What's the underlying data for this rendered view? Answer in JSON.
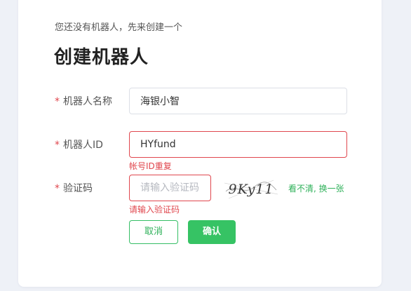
{
  "intro_text": "您还没有机器人，先来创建一个",
  "page_title": "创建机器人",
  "form": {
    "required_mark": "*",
    "name": {
      "label": "机器人名称",
      "value": "海银小智",
      "placeholder": ""
    },
    "robot_id": {
      "label": "机器人ID",
      "value": "HYfund",
      "placeholder": "",
      "error": "帐号ID重复"
    },
    "captcha": {
      "label": "验证码",
      "value": "",
      "placeholder": "请输入验证码",
      "error": "请输入验证码",
      "image_text": "9Ky11",
      "refresh_label": "看不清, 换一张"
    }
  },
  "buttons": {
    "cancel": "取消",
    "confirm": "确认"
  },
  "colors": {
    "accent": "#36c364",
    "error": "#e0474e",
    "background": "#eef1f7"
  }
}
